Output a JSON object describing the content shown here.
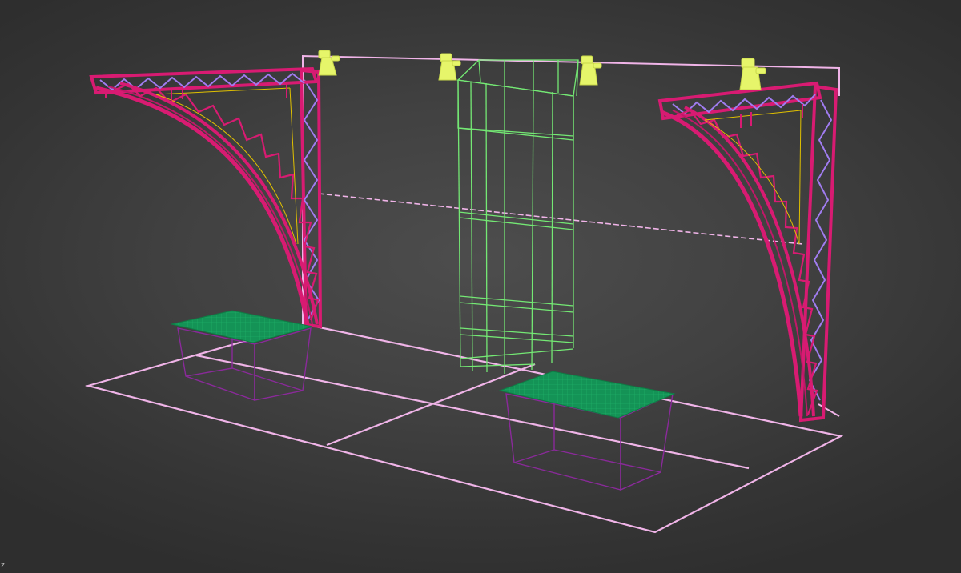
{
  "viewport": {
    "name": "perspective-viewport",
    "view_mode": "wireframe",
    "axis_glyph": "z"
  },
  "colors": {
    "background": "#444444",
    "floor_outline": "#f0b4e8",
    "truss_main": "#d81b72",
    "truss_cross": "#9a7cf0",
    "light_fixture": "#e6f56a",
    "tower_wire": "#7cf07c",
    "counter_top": "#159a5a",
    "counter_wire": "#8a2a9a",
    "inner_curve": "#e0c000"
  },
  "scene": {
    "objects": [
      {
        "name": "booth-floor-outline",
        "kind": "floor"
      },
      {
        "name": "back-wall-outline",
        "kind": "wall"
      },
      {
        "name": "left-curved-truss",
        "kind": "truss"
      },
      {
        "name": "right-curved-truss",
        "kind": "truss"
      },
      {
        "name": "center-display-tower",
        "kind": "wireframe-box"
      },
      {
        "name": "left-counter",
        "kind": "counter"
      },
      {
        "name": "right-counter",
        "kind": "counter"
      },
      {
        "name": "spotlight-1",
        "kind": "light"
      },
      {
        "name": "spotlight-2",
        "kind": "light"
      },
      {
        "name": "spotlight-3",
        "kind": "light"
      },
      {
        "name": "spotlight-4",
        "kind": "light"
      }
    ]
  }
}
